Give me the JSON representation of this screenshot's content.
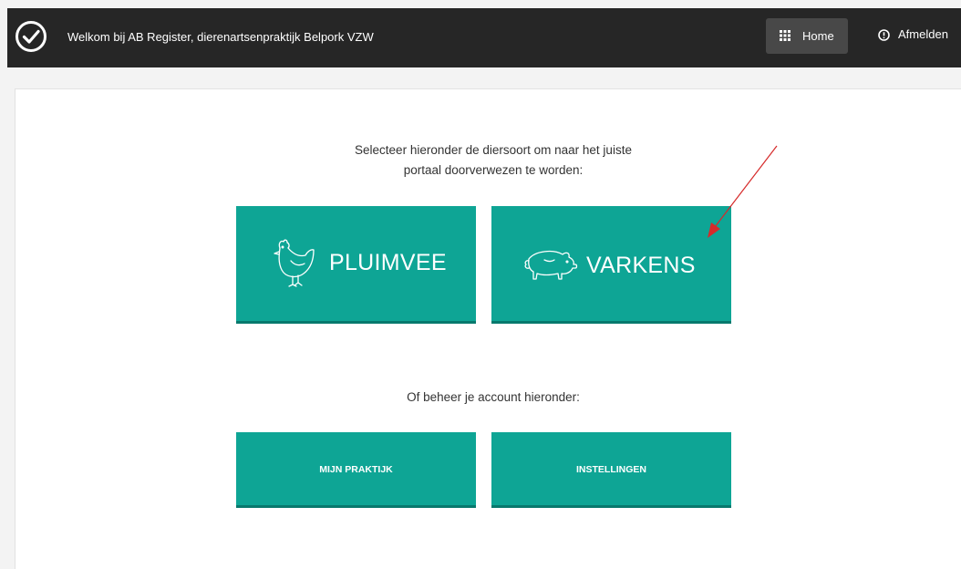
{
  "header": {
    "welcome_text": "Welkom bij AB Register, dierenartsenpraktijk Belpork VZW",
    "home_label": "Home",
    "logout_label": "Afmelden"
  },
  "main": {
    "intro_line1": "Selecteer hieronder de diersoort om naar het juiste",
    "intro_line2": "portaal doorverwezen te worden:",
    "species": [
      {
        "label": "PLUIMVEE",
        "icon": "chicken-icon"
      },
      {
        "label": "VARKENS",
        "icon": "pig-icon"
      }
    ],
    "account_intro": "Of beheer je account hieronder:",
    "account_buttons": [
      {
        "label": "MIJN PRAKTIJK"
      },
      {
        "label": "INSTELLINGEN"
      }
    ]
  },
  "colors": {
    "header_bg": "#262626",
    "accent": "#0ea595",
    "annotation_arrow": "#d62a2a"
  }
}
